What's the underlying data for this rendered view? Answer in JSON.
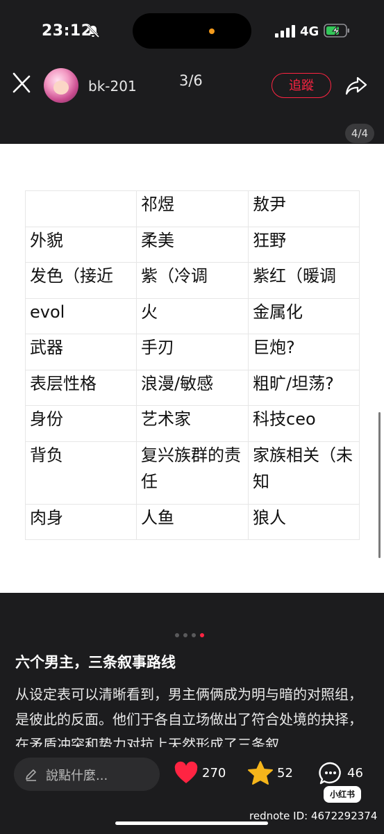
{
  "status": {
    "time": "23:12",
    "network": "4G"
  },
  "nav": {
    "username": "bk-201",
    "pager": "3/6",
    "follow_label": "追蹤"
  },
  "image": {
    "badge": "4/4",
    "table": {
      "header": [
        "",
        "祁煜",
        "敖尹"
      ],
      "rows": [
        [
          "外貌",
          "柔美",
          "狂野"
        ],
        [
          "发色（接近",
          "紫（冷调",
          "紫红（暖调"
        ],
        [
          "evol",
          "火",
          "金属化"
        ],
        [
          "武器",
          "手刃",
          "巨炮?"
        ],
        [
          "表层性格",
          "浪漫/敏感",
          "粗旷/坦荡?"
        ],
        [
          "身份",
          "艺术家",
          "科技ceo"
        ],
        [
          "背负",
          "复兴族群的责任",
          "家族相关（未知"
        ],
        [
          "肉身",
          "人鱼",
          "狼人"
        ]
      ]
    }
  },
  "post": {
    "title": "六个男主，三条叙事路线",
    "body": "从设定表可以清晰看到，男主俩俩成为明与暗的对照组，是彼此的反面。他们于各自立场做出了符合处境的抉择，在矛盾冲突和势力对抗上天然形成了三条叙"
  },
  "bottom": {
    "comment_placeholder": "說點什麼...",
    "likes": "270",
    "stars": "52",
    "comments": "46",
    "brand": "小红书",
    "watermark": "rednote ID: 4672292374"
  },
  "colors": {
    "accent": "#ff2442",
    "background": "#1c1c1e",
    "star": "#f5b51b"
  }
}
